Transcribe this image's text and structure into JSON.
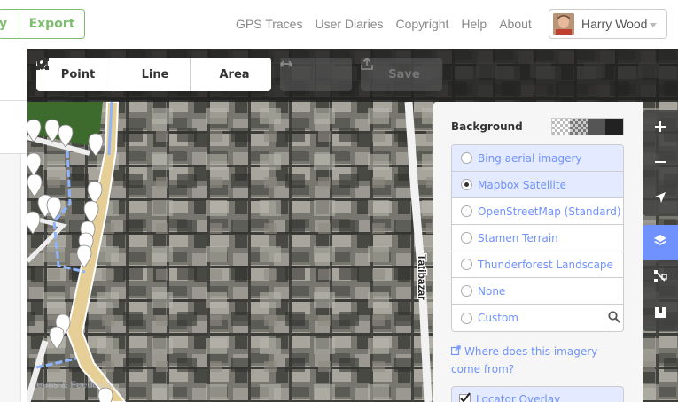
{
  "header": {
    "history_label": "y",
    "export_label": "Export",
    "nav_links": [
      "GPS Traces",
      "User Diaries",
      "Copyright",
      "Help",
      "About"
    ],
    "user_name": "Harry Wood"
  },
  "toolbar": {
    "point_label": "Point",
    "line_label": "Line",
    "area_label": "Area",
    "save_label": "Save"
  },
  "map": {
    "street_label": "Tatibazar",
    "terms_label": "Terms & Feedback"
  },
  "background_pane": {
    "title": "Background",
    "layers": [
      {
        "label": "Bing aerial imagery",
        "selected": false,
        "highlighted": true
      },
      {
        "label": "Mapbox Satellite",
        "selected": true,
        "highlighted": true
      },
      {
        "label": "OpenStreetMap (Standard)",
        "selected": false,
        "highlighted": false
      },
      {
        "label": "Stamen Terrain",
        "selected": false,
        "highlighted": false
      },
      {
        "label": "Thunderforest Landscape",
        "selected": false,
        "highlighted": false
      },
      {
        "label": "None",
        "selected": false,
        "highlighted": false
      },
      {
        "label": "Custom",
        "selected": false,
        "highlighted": false
      }
    ],
    "where_link": "Where does this imagery come from?",
    "locator_label": "Locator Overlay"
  },
  "colors": {
    "osm_green": "#7ebc6f",
    "id_blue": "#7092ff",
    "pane_bg": "#f6f6f6",
    "control_bg": "#404040"
  }
}
